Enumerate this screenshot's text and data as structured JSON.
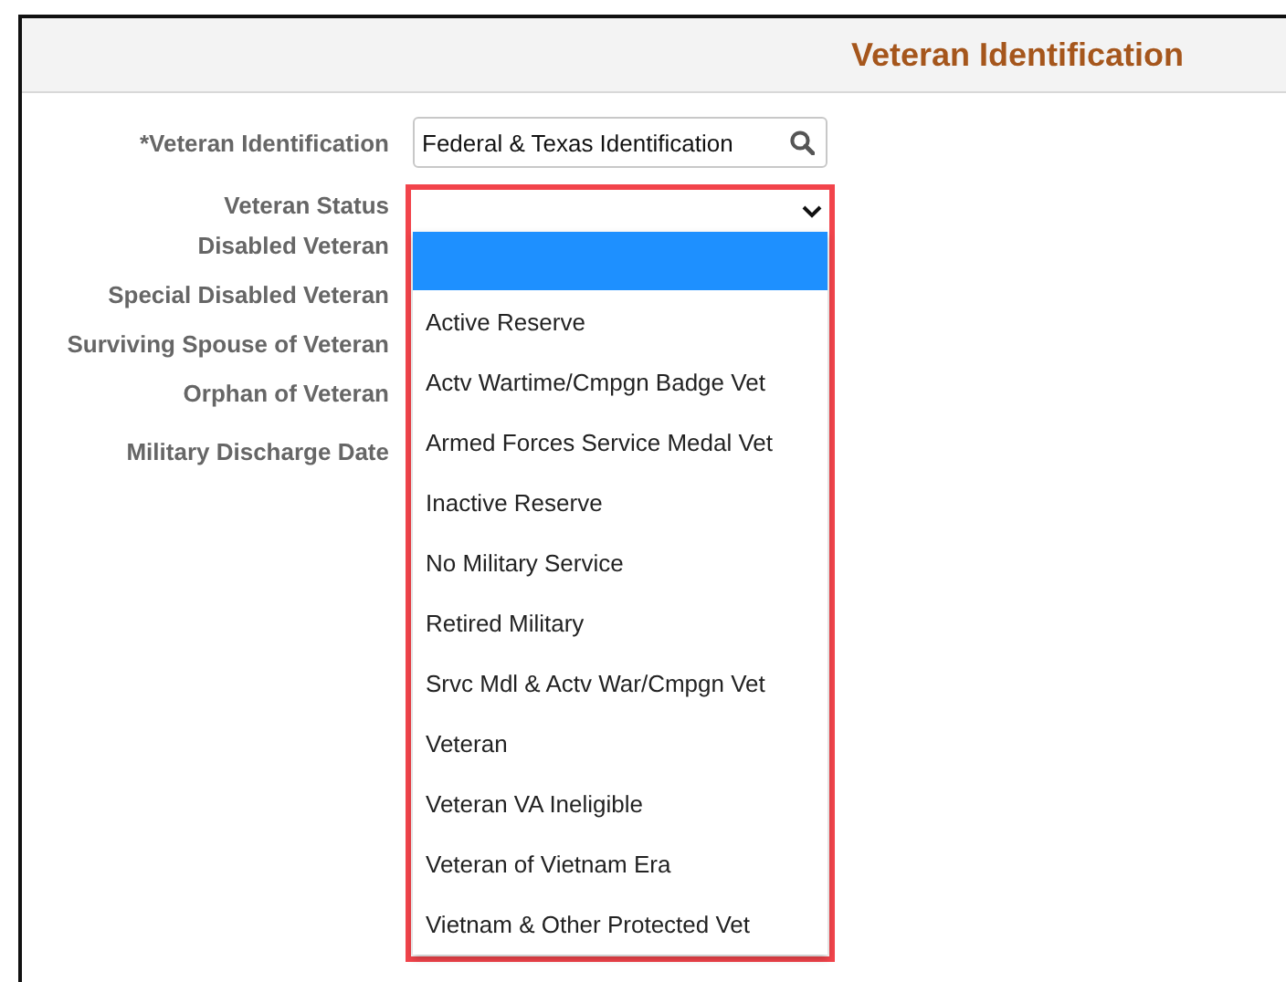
{
  "header": {
    "title": "Veteran Identification"
  },
  "fields": [
    {
      "kind": "lookup",
      "label": "*Veteran Identification",
      "value": "Federal & Texas Identification"
    },
    {
      "kind": "dropdown",
      "label": "Veteran Status",
      "expanded": true,
      "options": [
        {
          "selected": true
        },
        {
          "label": "Active Reserve",
          "selected": false
        },
        {
          "label": "Actv Wartime/Cmpgn Badge Vet",
          "selected": false
        },
        {
          "label": "Armed Forces Service Medal Vet",
          "selected": false
        },
        {
          "label": "Inactive Reserve",
          "selected": false
        },
        {
          "label": "No Military Service",
          "selected": false
        },
        {
          "label": "Retired Military",
          "selected": false
        },
        {
          "label": "Srvc Mdl & Actv War/Cmpgn Vet",
          "selected": false
        },
        {
          "label": "Veteran",
          "selected": false
        },
        {
          "label": "Veteran VA Ineligible",
          "selected": false
        },
        {
          "label": "Veteran of Vietnam Era",
          "selected": false
        },
        {
          "label": "Vietnam & Other Protected Vet",
          "selected": false
        }
      ]
    },
    {
      "kind": "hidden",
      "label": "Disabled Veteran"
    },
    {
      "kind": "hidden",
      "label": "Special Disabled Veteran"
    },
    {
      "kind": "hidden",
      "label": "Surviving Spouse of Veteran"
    },
    {
      "kind": "hidden",
      "label": "Orphan of Veteran"
    },
    {
      "kind": "hidden",
      "label": "Military Discharge Date"
    }
  ]
}
